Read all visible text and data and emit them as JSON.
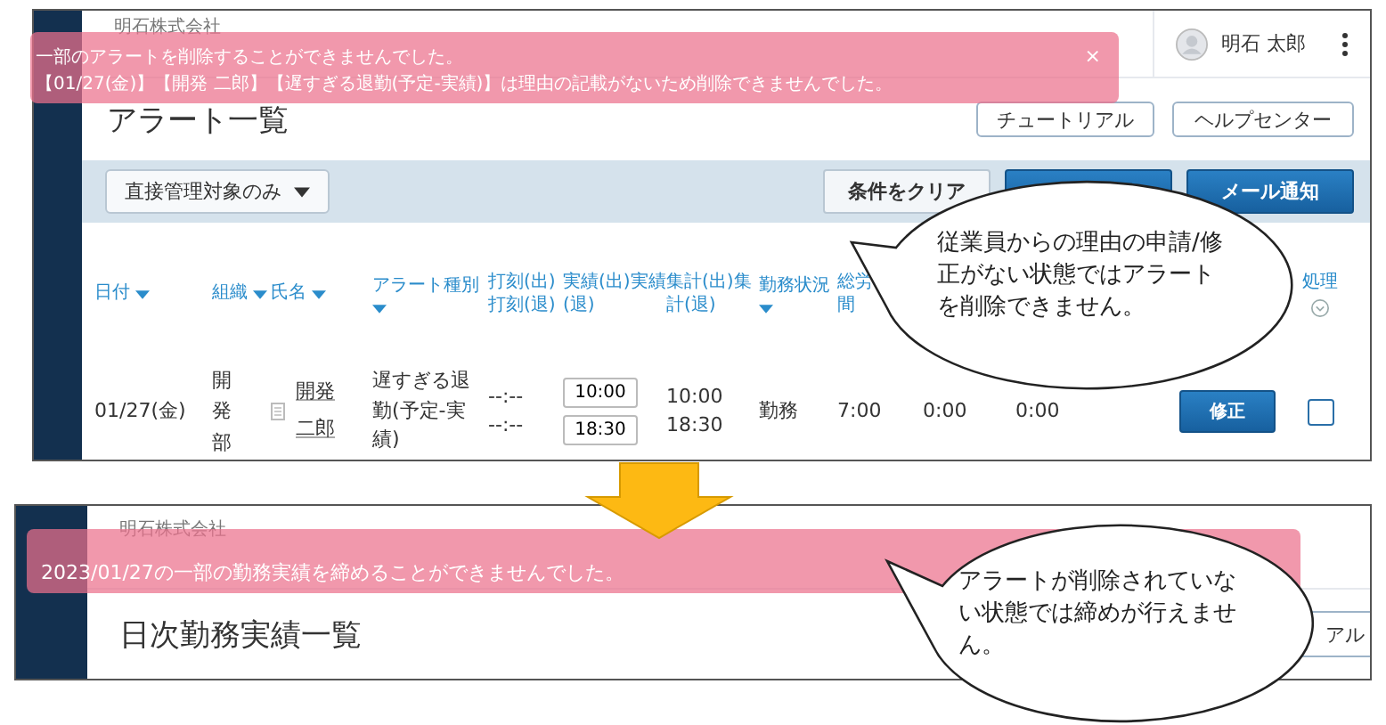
{
  "alert_screen": {
    "company": "明石株式会社",
    "user": {
      "name": "明石 太郎"
    },
    "title": "アラート一覧",
    "header_buttons": [
      "チュートリアル",
      "ヘルプセンター"
    ],
    "filter_dropdown": {
      "label": "直接管理対象のみ"
    },
    "action_buttons": [
      {
        "kind": "outline",
        "label": "条件をクリア"
      },
      {
        "kind": "primary"
      },
      {
        "kind": "primary",
        "label": "メール通知"
      }
    ],
    "table": {
      "columns": [
        {
          "kind": "sort",
          "label": "日付"
        },
        {
          "kind": "sort",
          "label": "組織"
        },
        {
          "kind": "sort",
          "label": "氏名"
        },
        {
          "kind": "sort",
          "label": "アラート種別"
        },
        {
          "kind": "plain",
          "label": "打刻(出)打刻(退)"
        },
        {
          "kind": "plain",
          "label": "実績(出)実績(退)"
        },
        {
          "kind": "plain",
          "label": "集計(出)集計(退)"
        },
        {
          "kind": "sort",
          "label": "勤務状況"
        },
        {
          "kind": "plain",
          "label": "総労間"
        },
        {
          "kind": "empty"
        },
        {
          "kind": "empty"
        },
        {
          "kind": "empty"
        },
        {
          "kind": "empty"
        },
        {
          "kind": "menu",
          "label": "処理"
        }
      ],
      "rows": [
        {
          "cells": [
            {
              "kind": "text",
              "text": "01/27(金)"
            },
            {
              "kind": "vertical",
              "text": "開発部"
            },
            {
              "kind": "link",
              "text": "開発二郎"
            },
            {
              "kind": "text",
              "text": "遅すぎる退勤(予定-実績)"
            },
            {
              "kind": "lines",
              "lines": [
                "--:--",
                "--:--"
              ]
            },
            {
              "kind": "inputs",
              "values": [
                "10:00",
                "18:30"
              ]
            },
            {
              "kind": "lines",
              "lines": [
                "10:00",
                "18:30"
              ]
            },
            {
              "kind": "text",
              "text": "勤務"
            },
            {
              "kind": "text",
              "text": "7:00"
            },
            {
              "kind": "text",
              "text": "0:00"
            },
            {
              "kind": "text",
              "text": "0:00"
            },
            {
              "kind": "empty"
            },
            {
              "kind": "button",
              "text": "修正"
            },
            {
              "kind": "checkbox",
              "checked": false
            }
          ]
        }
      ]
    },
    "toast": {
      "lines": [
        "一部のアラートを削除することができませんでした。",
        "【01/27(金)】【開発 二郎】【遅すぎる退勤(予定-実績)】は理由の記載がないため削除できませんでした。"
      ],
      "close": "×"
    },
    "callout": {
      "text": "従業員からの理由の申請/修正がない状態ではアラートを削除できません。"
    }
  },
  "daily_screen": {
    "company": "明石株式会社",
    "title": "日次勤務実績一覧",
    "header_button": "アル",
    "toast": {
      "lines": [
        "2023/01/27の一部の勤務実績を締めることができませんでした。"
      ]
    },
    "callout": {
      "text": "アラートが削除されていない状態では締めが行えません。"
    }
  }
}
